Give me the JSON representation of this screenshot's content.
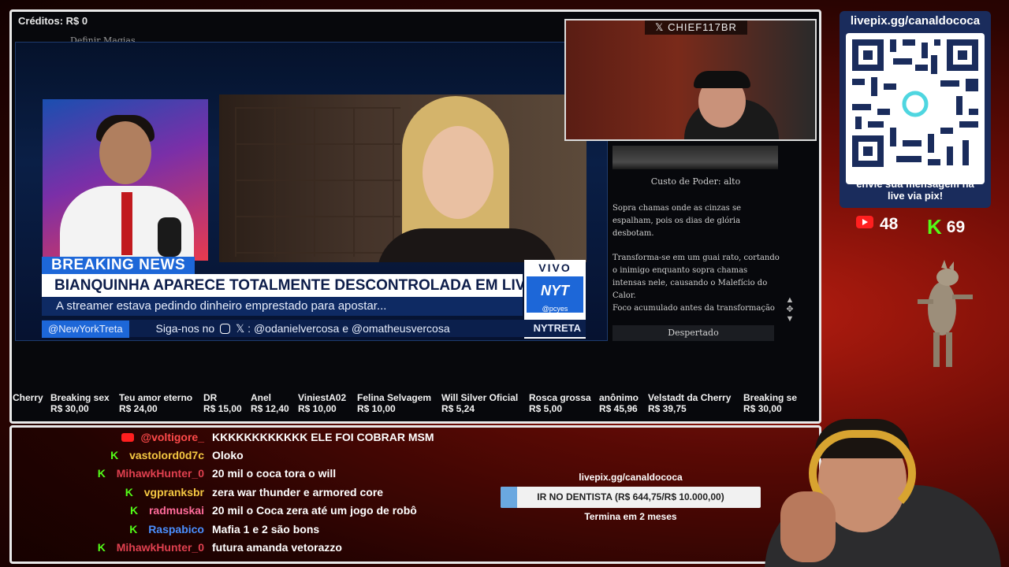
{
  "game": {
    "credits": "Créditos: R$ 0",
    "define_magic": "Definir Magias"
  },
  "news": {
    "breaking": "BREAKING NEWS",
    "headline": "BIANQUINHA APARECE TOTALMENTE DESCONTROLADA EM LIVE",
    "subheadline": "A streamer estava pedindo dinheiro emprestado para apostar...",
    "live_label": "VIVO",
    "logo": "NYT",
    "logo_sub": "@pcyes",
    "handle": "@NewYorkTreta",
    "follow_prefix": "Siga-nos no",
    "follow_suffix": ": @odanielvercosa e @omatheusvercosa",
    "channel": "NYTRETA"
  },
  "spell": {
    "power_cost": "Custo de Poder: alto",
    "desc1": "Sopra chamas onde as cinzas se espalham, pois os dias de glória desbotam.",
    "desc2": "Transforma-se em um guai rato, cortando o inimigo enquanto sopra chamas intensas nele, causando o Malefício do Calor.",
    "desc3": "Foco acumulado antes da transformação",
    "awaken": "Despertado"
  },
  "cam_label": "CHIEF117BR",
  "tips": [
    {
      "name": "Cherry",
      "amount": ""
    },
    {
      "name": "Breaking sex",
      "amount": "R$ 30,00"
    },
    {
      "name": "Teu amor eterno",
      "amount": "R$ 24,00"
    },
    {
      "name": "DR",
      "amount": "R$ 15,00"
    },
    {
      "name": "Anel",
      "amount": "R$ 12,40"
    },
    {
      "name": "ViniestA02",
      "amount": "R$ 10,00"
    },
    {
      "name": "Felina Selvagem",
      "amount": "R$ 10,00"
    },
    {
      "name": "Will Silver Oficial",
      "amount": "R$ 5,24"
    },
    {
      "name": "Rosca grossa",
      "amount": "R$ 5,00"
    },
    {
      "name": "anônimo",
      "amount": "R$ 45,96"
    },
    {
      "name": "Velstadt da Cherry",
      "amount": "R$ 39,75"
    },
    {
      "name": "Breaking se",
      "amount": "R$ 30,00"
    }
  ],
  "chat": [
    {
      "platform": "youtube",
      "user": "@voltigore_",
      "color": "#ff4a4a",
      "message": "KKKKKKKKKKKK ELE FOI COBRAR MSM"
    },
    {
      "platform": "kick",
      "user": "vastolord0d7c",
      "color": "#f5c842",
      "message": "Oloko"
    },
    {
      "platform": "kick",
      "user": "MihawkHunter_0",
      "color": "#e0404f",
      "message": "20 mil o coca tora o will"
    },
    {
      "platform": "kick",
      "user": "vgpranksbr",
      "color": "#f5c842",
      "message": "zera war thunder e armored core"
    },
    {
      "platform": "kick",
      "user": "radmuskai",
      "color": "#ff6b9a",
      "message": "20 mil o Coca zera até um jogo de robô"
    },
    {
      "platform": "kick",
      "user": "Raspabico",
      "color": "#4a8fff",
      "message": "Mafia 1 e 2 são bons"
    },
    {
      "platform": "kick",
      "user": "MihawkHunter_0",
      "color": "#e0404f",
      "message": "futura amanda vetorazzo"
    }
  ],
  "goal": {
    "url": "livepix.gg/canaldococa",
    "text": "IR NO DENTISTA (R$ 644,75/R$ 10.000,00)",
    "progress": 0.0645,
    "deadline": "Termina em 2 meses",
    "fill_color": "#6aa8e0"
  },
  "livepix": {
    "url": "livepix.gg/canaldococa",
    "message_line1": "envie sua mensagem na",
    "message_line2": "live via pix!"
  },
  "viewers": {
    "youtube": "48",
    "kick": "69"
  },
  "colors": {
    "news_blue": "#1d67d8",
    "kick_green": "#53fc18",
    "youtube_red": "#ff1f1f"
  }
}
